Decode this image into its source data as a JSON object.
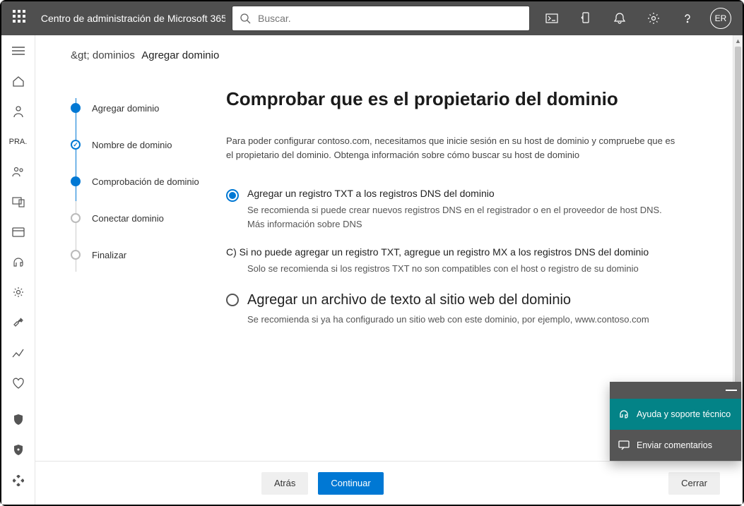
{
  "top": {
    "app_title": "Centro de administración de Microsoft 365",
    "search_placeholder": "Buscar.",
    "avatar_initials": "ER"
  },
  "rail_text": "PRA.",
  "breadcrumb": {
    "prev": "&gt; dominios",
    "current": "Agregar dominio"
  },
  "steps": {
    "s1": "Agregar dominio",
    "s2": "Nombre de dominio",
    "s3": "Comprobación de dominio",
    "s4": "Conectar dominio",
    "s5": "Finalizar"
  },
  "page": {
    "title": "Comprobar que es el propietario del dominio",
    "intro": "Para poder configurar contoso.com, necesitamos que inicie sesión en su host de dominio y compruebe que es el propietario del dominio. Obtenga información sobre cómo buscar su host de dominio"
  },
  "options": {
    "optA": {
      "title": "Agregar un registro TXT a los registros DNS del dominio",
      "desc": "Se recomienda si puede crear nuevos registros DNS en el registrador o en el proveedor de host DNS. Más información sobre DNS"
    },
    "optC": {
      "title": "C) Si no puede agregar un registro TXT, agregue un registro MX a los registros DNS del dominio",
      "desc": "Solo se recomienda si los registros TXT no son compatibles con el host o registro de su dominio"
    },
    "optD": {
      "title": "Agregar un archivo de texto al sitio web del dominio",
      "desc": "Se recomienda si ya ha configurado un sitio web con este dominio, por ejemplo, www.contoso.com"
    }
  },
  "buttons": {
    "back": "Atrás",
    "continue": "Continuar",
    "close": "Cerrar"
  },
  "help": {
    "support": "Ayuda y soporte técnico",
    "feedback": "Enviar comentarios"
  }
}
